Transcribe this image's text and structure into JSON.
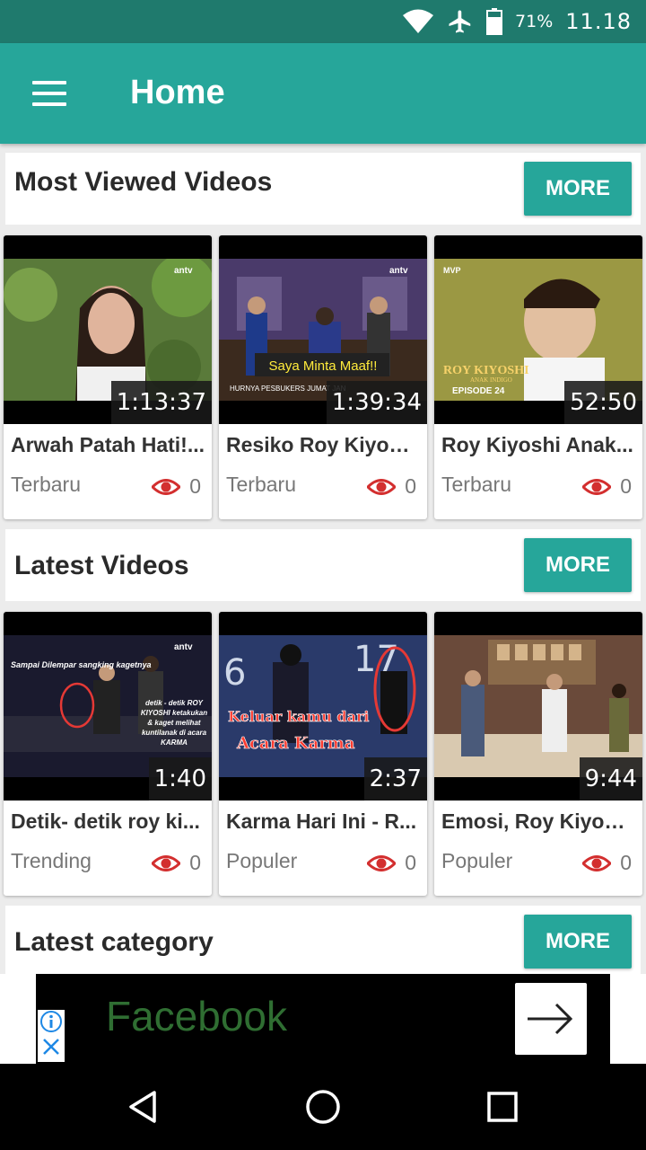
{
  "status_bar": {
    "battery_percent": "71%",
    "time": "11.18",
    "icons": [
      "wifi-icon",
      "airplane-icon",
      "battery-icon"
    ]
  },
  "app_bar": {
    "title": "Home",
    "menu_icon": "hamburger-menu-icon"
  },
  "sections": [
    {
      "title": "Most Viewed Videos",
      "more_label": "MORE",
      "videos": [
        {
          "title": "Arwah Patah Hati!...",
          "category": "Terbaru",
          "views": "0",
          "duration": "1:13:37",
          "channel_logo": "antv"
        },
        {
          "title": "Resiko Roy Kiyosh...",
          "category": "Terbaru",
          "views": "0",
          "duration": "1:39:34",
          "channel_logo": "antv",
          "caption": "Saya Minta Maaf!!",
          "ticker": "HURNYA PESBUKERS JUMAT JAN"
        },
        {
          "title": "Roy Kiyoshi Anak...",
          "category": "Terbaru",
          "views": "0",
          "duration": "52:50",
          "caption": "ROY KIYOSHI",
          "subcaption": "ANAK INDIGO",
          "episode": "EPISODE 24",
          "channel_logo": "MVP"
        }
      ]
    },
    {
      "title": "Latest Videos",
      "more_label": "MORE",
      "videos": [
        {
          "title": "Detik- detik roy ki...",
          "category": "Trending",
          "views": "0",
          "duration": "1:40",
          "channel_logo": "antv",
          "caption": "Sampai Dilempar sangking kagetnya",
          "subcaption": "detik - detik ROY KIYOSHI ketakukan & kaget melihat kuntilanak di acara KARMA"
        },
        {
          "title": "Karma Hari Ini - R...",
          "category": "Populer",
          "views": "0",
          "duration": "2:37",
          "caption": "Keluar kamu dari",
          "subcaption": "Acara Karma"
        },
        {
          "title": "Emosi, Roy Kiyosh...",
          "category": "Populer",
          "views": "0",
          "duration": "9:44"
        }
      ]
    },
    {
      "title": "Latest category",
      "more_label": "MORE"
    }
  ],
  "ad": {
    "text": "Facebook",
    "info_icon": "info-icon",
    "close_icon": "close-x-icon",
    "arrow_icon": "arrow-right-icon"
  },
  "nav_bar": {
    "buttons": [
      "back-triangle-icon",
      "home-circle-icon",
      "recents-square-icon"
    ]
  },
  "colors": {
    "status_bar": "#1f7a6d",
    "primary": "#26a69a",
    "eye_icon": "#d32f2f",
    "background": "#ececec"
  }
}
